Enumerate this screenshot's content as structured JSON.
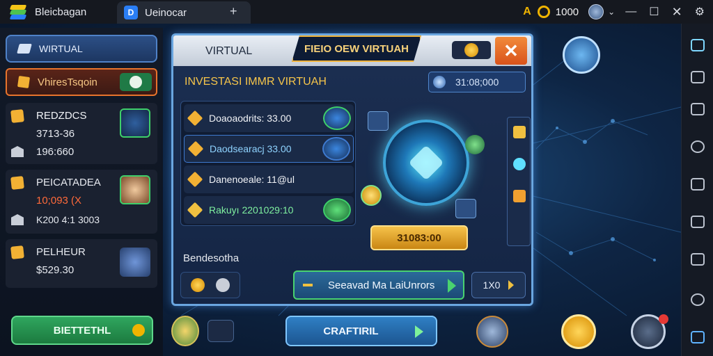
{
  "topbar": {
    "app_title": "Bleicbagan",
    "tab_label": "Ueinocar",
    "tab_add": "+",
    "coins": "1000",
    "icons": [
      "alert-icon",
      "coin-icon",
      "profile-icon",
      "minimize-icon",
      "maximize-icon",
      "close-icon"
    ]
  },
  "sidebar": {
    "virtual_label": "WIRTUAL",
    "active_tab_label": "VhiresTsqoin",
    "cards": [
      {
        "title": "REDZDCS",
        "line1": "3713-36",
        "line2": "196:660"
      },
      {
        "title": "PEICATADEA",
        "line1": "10;093 (X",
        "line2": "K200 4:1 3003"
      },
      {
        "title": "PELHEUR",
        "line1": "$529.30"
      }
    ],
    "bottom_button": "BIETTETHL"
  },
  "dialog": {
    "title": "VIRTUAL",
    "banner": "FIEIO OEW VIRTUAH",
    "heading": "INVESTASI IMMR VIRTUAH",
    "value": "31:08;000",
    "assets": [
      {
        "label": "Doaoaodrits: 33.00",
        "color": "#f1f3f7",
        "accent": "#f2b134"
      },
      {
        "label": "Daodsearacj 33.00",
        "color": "#8fd3ff",
        "accent": "#f2b134"
      },
      {
        "label": "Danenoeale: 11@ul",
        "color": "#f1f3f7",
        "accent": "#f2b134"
      },
      {
        "label": "Rakuyı 2201029:10",
        "color": "#7ff0a0",
        "accent": "#f2b134"
      }
    ],
    "subheading": "Bendesotha",
    "action_button": "Seeavad Ma LaiUnrors",
    "count_button": "1X0",
    "emblem_value": "31083:00"
  },
  "bottom": {
    "main_button": "CRAFTIRIL"
  }
}
